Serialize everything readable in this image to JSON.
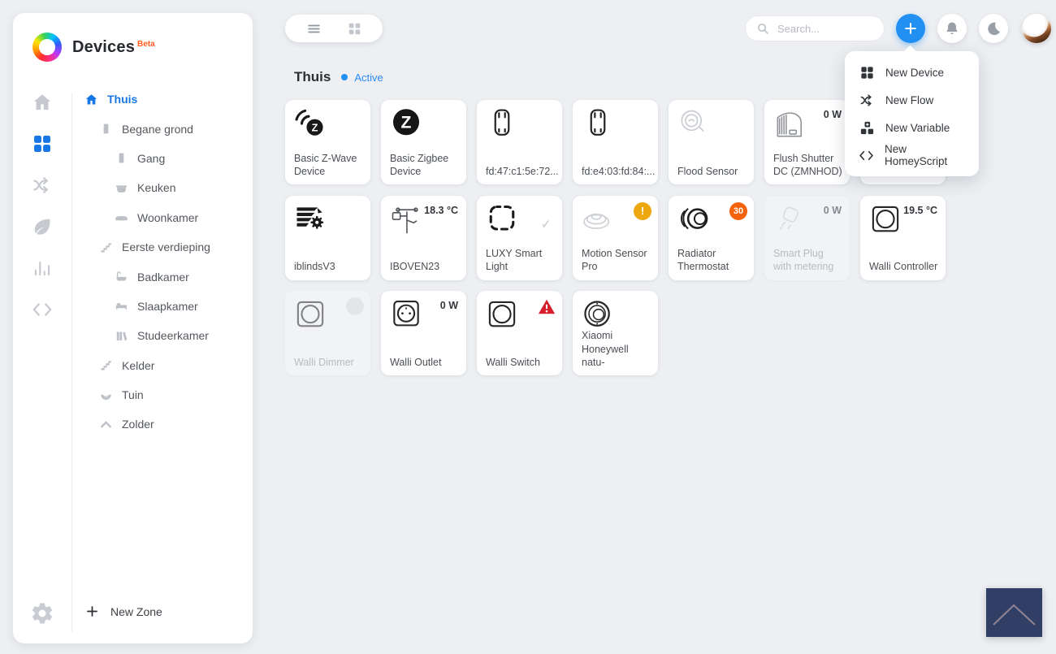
{
  "app": {
    "title": "Devices",
    "beta": "Beta"
  },
  "colors": {
    "accent_blue": "#2190f2",
    "nav_blue": "#1877e6",
    "beta_orange": "#ff5a1f",
    "amber_badge": "#eda70f",
    "orange_badge": "#f4630c",
    "red_badge": "#d51f2c",
    "page_bg": "#edeff2",
    "scrolltop_bg": "#313e66"
  },
  "rail": {
    "items": [
      {
        "id": "home",
        "icon": "home",
        "active": false
      },
      {
        "id": "devices",
        "icon": "devices",
        "active": true
      },
      {
        "id": "flow",
        "icon": "flow",
        "active": false
      },
      {
        "id": "energy",
        "icon": "energy",
        "active": false
      },
      {
        "id": "insights",
        "icon": "insights",
        "active": false
      },
      {
        "id": "script",
        "icon": "script",
        "active": false
      }
    ],
    "settings_icon": "gear"
  },
  "zones": {
    "items": [
      {
        "label": "Thuis",
        "icon": "house",
        "level": 0,
        "active": true
      },
      {
        "label": "Begane grond",
        "icon": "pillar",
        "level": 1,
        "active": false
      },
      {
        "label": "Gang",
        "icon": "pillar",
        "level": 2,
        "active": false
      },
      {
        "label": "Keuken",
        "icon": "pot",
        "level": 2,
        "active": false
      },
      {
        "label": "Woonkamer",
        "icon": "couch",
        "level": 2,
        "active": false
      },
      {
        "label": "Eerste verdieping",
        "icon": "stairs",
        "level": 1,
        "active": false
      },
      {
        "label": "Badkamer",
        "icon": "bath",
        "level": 2,
        "active": false
      },
      {
        "label": "Slaapkamer",
        "icon": "bed",
        "level": 2,
        "active": false
      },
      {
        "label": "Studeerkamer",
        "icon": "books",
        "level": 2,
        "active": false
      },
      {
        "label": "Kelder",
        "icon": "stairs",
        "level": 1,
        "active": false
      },
      {
        "label": "Tuin",
        "icon": "plant",
        "level": 1,
        "active": false
      },
      {
        "label": "Zolder",
        "icon": "roof",
        "level": 1,
        "active": false
      }
    ],
    "new_zone_label": "New Zone"
  },
  "toolbar": {
    "views": [
      {
        "id": "list",
        "icon": "view-list",
        "active": false
      },
      {
        "id": "grid",
        "icon": "view-grid",
        "active": true
      },
      {
        "id": "grid-small",
        "icon": "view-grid-small",
        "active": false
      }
    ],
    "search_placeholder": "Search..."
  },
  "page": {
    "zone_title": "Thuis",
    "status": "Active"
  },
  "create_menu": {
    "items": [
      {
        "label": "New Device",
        "icon": "menu-device"
      },
      {
        "label": "New Flow",
        "icon": "flow"
      },
      {
        "label": "New Variable",
        "icon": "menu-variable"
      },
      {
        "label": "New HomeyScript",
        "icon": "script"
      }
    ]
  },
  "devices": [
    {
      "name": "Basic Z-Wave Device",
      "icon": "zwave"
    },
    {
      "name": "Basic Zigbee Device",
      "icon": "zigbee"
    },
    {
      "name": "fd:47:c1:5e:72...",
      "icon": "node"
    },
    {
      "name": "fd:e4:03:fd:84:...",
      "icon": "node"
    },
    {
      "name": "Flood Sensor",
      "icon": "flood"
    },
    {
      "name": "Flush Shutter DC (ZMNHOD)",
      "icon": "shutter",
      "status": "0 W"
    },
    {
      "name": "",
      "icon": "",
      "covered": true
    },
    {
      "name": "iblindsV3",
      "icon": "blinds"
    },
    {
      "name": "IBOVEN23",
      "icon": "weather",
      "status": "18.3 °C"
    },
    {
      "name": "LUXY Smart Light",
      "icon": "luxy",
      "badge": "check"
    },
    {
      "name": "Motion Sensor Pro",
      "icon": "motion",
      "badge": "alert",
      "badge_value": "!"
    },
    {
      "name": "Radiator Thermostat",
      "icon": "valve",
      "badge": "count",
      "badge_value": "30"
    },
    {
      "name": "Smart Plug with metering",
      "icon": "plug",
      "status": "0 W",
      "dimmed": true
    },
    {
      "name": "Walli Controller",
      "icon": "walli",
      "status": "19.5 °C"
    },
    {
      "name": "Walli Dimmer",
      "icon": "walli",
      "badge": "dot",
      "dimmed": true
    },
    {
      "name": "Walli Outlet",
      "icon": "outlet",
      "status": "0 W"
    },
    {
      "name": "Walli Switch",
      "icon": "walli",
      "badge": "error"
    },
    {
      "name": "Xiaomi Honeywell natu-",
      "icon": "smoke"
    }
  ]
}
